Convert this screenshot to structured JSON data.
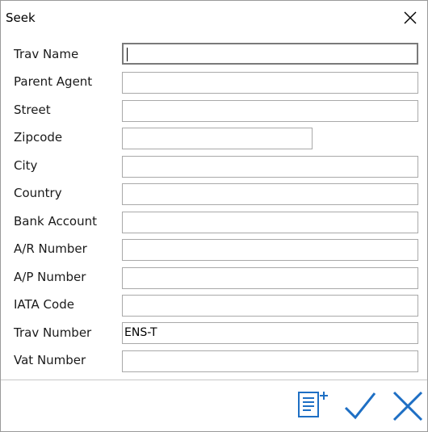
{
  "dialog": {
    "title": "Seek"
  },
  "fields": [
    {
      "label": "Trav Name",
      "value": ""
    },
    {
      "label": "Parent Agent",
      "value": ""
    },
    {
      "label": "Street",
      "value": ""
    },
    {
      "label": "Zipcode",
      "value": ""
    },
    {
      "label": "City",
      "value": ""
    },
    {
      "label": "Country",
      "value": ""
    },
    {
      "label": "Bank Account",
      "value": ""
    },
    {
      "label": "A/R Number",
      "value": ""
    },
    {
      "label": "A/P Number",
      "value": ""
    },
    {
      "label": "IATA Code",
      "value": ""
    },
    {
      "label": "Trav Number",
      "value": "ENS-T"
    },
    {
      "label": "Vat Number",
      "value": ""
    }
  ],
  "footer": {
    "icons": [
      "add-list-icon",
      "checkmark-icon",
      "close-icon"
    ]
  },
  "colors": {
    "accent": "#1e6fc4",
    "border": "#a9a9a9"
  }
}
